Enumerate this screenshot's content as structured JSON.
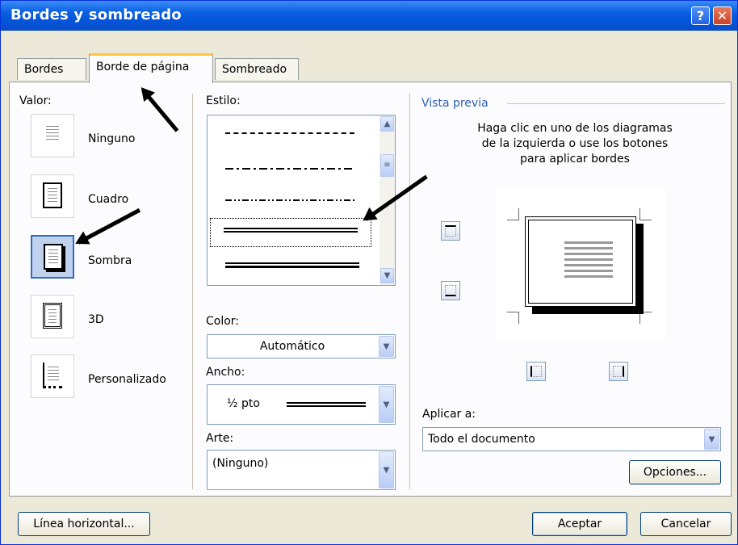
{
  "window": {
    "title": "Bordes y sombreado",
    "help_glyph": "?",
    "close_glyph": "✕"
  },
  "tabs": [
    {
      "label": "Bordes"
    },
    {
      "label": "Borde de página"
    },
    {
      "label": "Sombreado"
    }
  ],
  "valor": {
    "label": "Valor:",
    "items": [
      {
        "label": "Ninguno"
      },
      {
        "label": "Cuadro"
      },
      {
        "label": "Sombra"
      },
      {
        "label": "3D"
      },
      {
        "label": "Personalizado"
      }
    ]
  },
  "estilo": {
    "label": "Estilo:"
  },
  "color": {
    "label": "Color:",
    "value": "Automático"
  },
  "ancho": {
    "label": "Ancho:",
    "value": "½ pto"
  },
  "arte": {
    "label": "Arte:",
    "value": "(Ninguno)"
  },
  "vista_previa": {
    "label": "Vista previa",
    "instructions": "Haga clic en uno de los diagramas de la izquierda o use los botones para aplicar bordes"
  },
  "aplicar": {
    "label": "Aplicar a:",
    "value": "Todo el documento"
  },
  "buttons": {
    "opciones": "Opciones...",
    "linea_horizontal": "Línea horizontal...",
    "aceptar": "Aceptar",
    "cancelar": "Cancelar"
  },
  "colors": {
    "titlebar": "#0454d8",
    "dialog_bg": "#ece9d8",
    "selection": "#316ac5",
    "tab_highlight": "#ffc83c"
  }
}
